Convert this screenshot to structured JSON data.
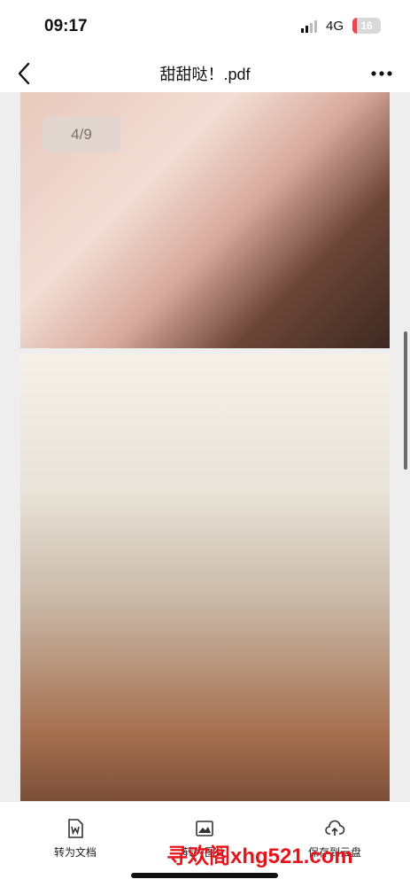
{
  "status_bar": {
    "time": "09:17",
    "network": "4G",
    "battery": "16",
    "battery_level": 0.16
  },
  "nav": {
    "title": "甜甜哒！.pdf",
    "back_icon": "chevron-left-icon",
    "more_icon": "more-horizontal-icon"
  },
  "viewer": {
    "page_indicator": "4/9"
  },
  "toolbar": {
    "items": [
      {
        "label": "转为文档",
        "icon": "word-doc-icon"
      },
      {
        "label": "转为图片",
        "icon": "image-icon"
      },
      {
        "label": "保存到云盘",
        "icon": "cloud-upload-icon"
      }
    ]
  },
  "watermark": {
    "text": "寻欢阁xhg521.com"
  },
  "colors": {
    "battery_low": "#e5484d",
    "watermark": "#e8141b"
  }
}
